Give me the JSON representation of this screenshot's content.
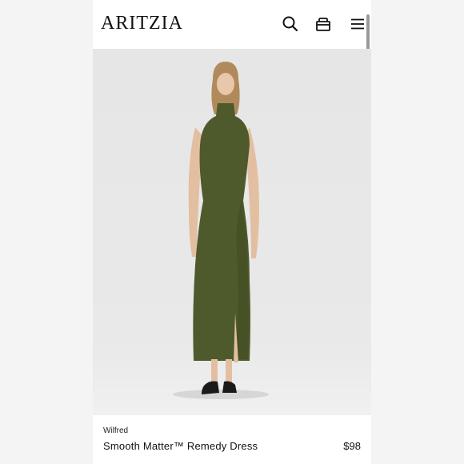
{
  "header": {
    "logo": "ARITZIA",
    "icons": [
      "search-icon",
      "shopping-bag-icon",
      "menu-icon"
    ]
  },
  "product": {
    "brand": "Wilfred",
    "name": "Smooth Matter™ Remedy Dress",
    "price": "$98",
    "dress_color": "#4e5a2b"
  },
  "colors": {
    "background": "#f4f4f4",
    "photo_background": "#e8e8e8",
    "text": "#111111"
  }
}
